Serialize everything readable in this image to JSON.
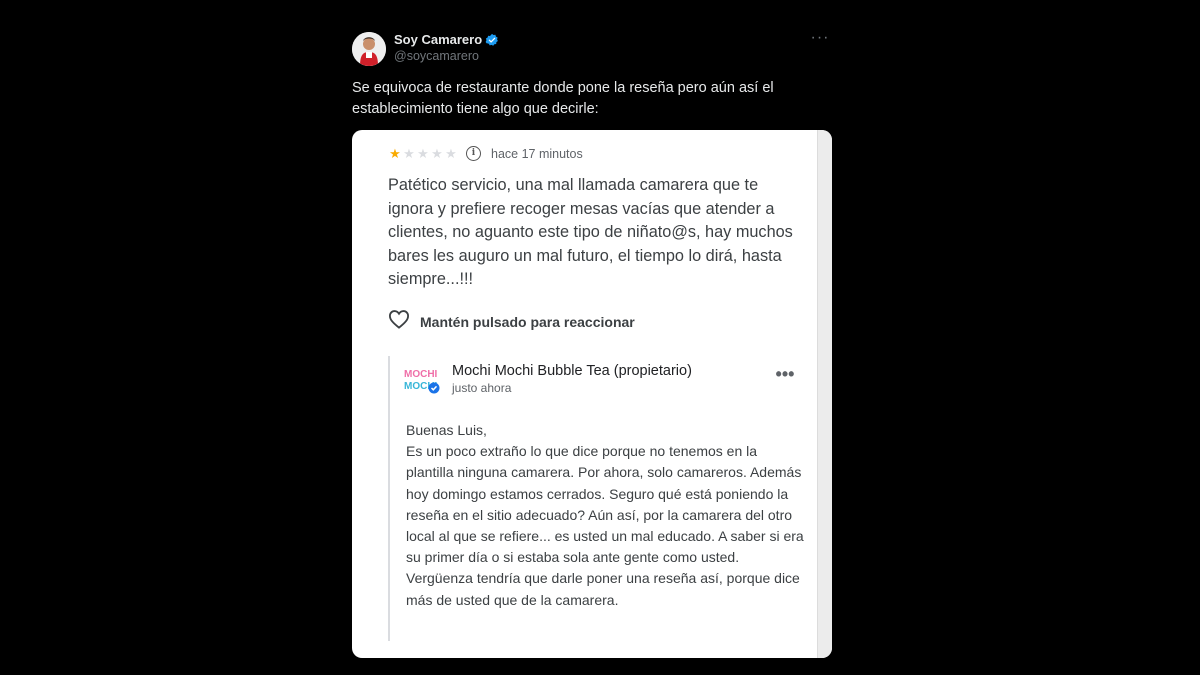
{
  "tweet": {
    "author": {
      "display_name": "Soy Camarero",
      "handle": "@soycamarero",
      "verified": true
    },
    "more_icon": "more-horizontal-icon",
    "text": "Se equivoca de restaurante donde pone la reseña pero aún así el establecimiento tiene algo que decirle:"
  },
  "review": {
    "rating": 1,
    "rating_max": 5,
    "star_filled_color": "#f9ab00",
    "star_empty_color": "#dadce0",
    "time": "hace 17 minutos",
    "text": "Patético servicio, una mal llamada camarera que te ignora y prefiere recoger mesas vacías que atender a clientes, no aguanto este tipo de niñato@s, hay muchos bares les auguro un mal futuro, el tiempo lo dirá, hasta siempre...!!!",
    "react_label": "Mantén pulsado para reaccionar"
  },
  "owner_reply": {
    "logo_text_top": "MOCHI",
    "logo_text_bottom": "MOCHI",
    "name": "Mochi Mochi Bubble Tea (propietario)",
    "time": "justo ahora",
    "greeting": "Buenas Luis,",
    "body": "Es un poco extraño lo que dice porque no tenemos en la plantilla ninguna camarera. Por ahora, solo camareros. Además hoy domingo estamos cerrados. Seguro qué está poniendo la reseña en el sitio adecuado? Aún así, por la camarera del otro local al que se refiere... es usted un mal educado. A saber si era su primer día o si estaba sola ante gente como usted. Vergüenza tendría que darle poner una reseña así, porque dice más de usted que de la camarera."
  }
}
